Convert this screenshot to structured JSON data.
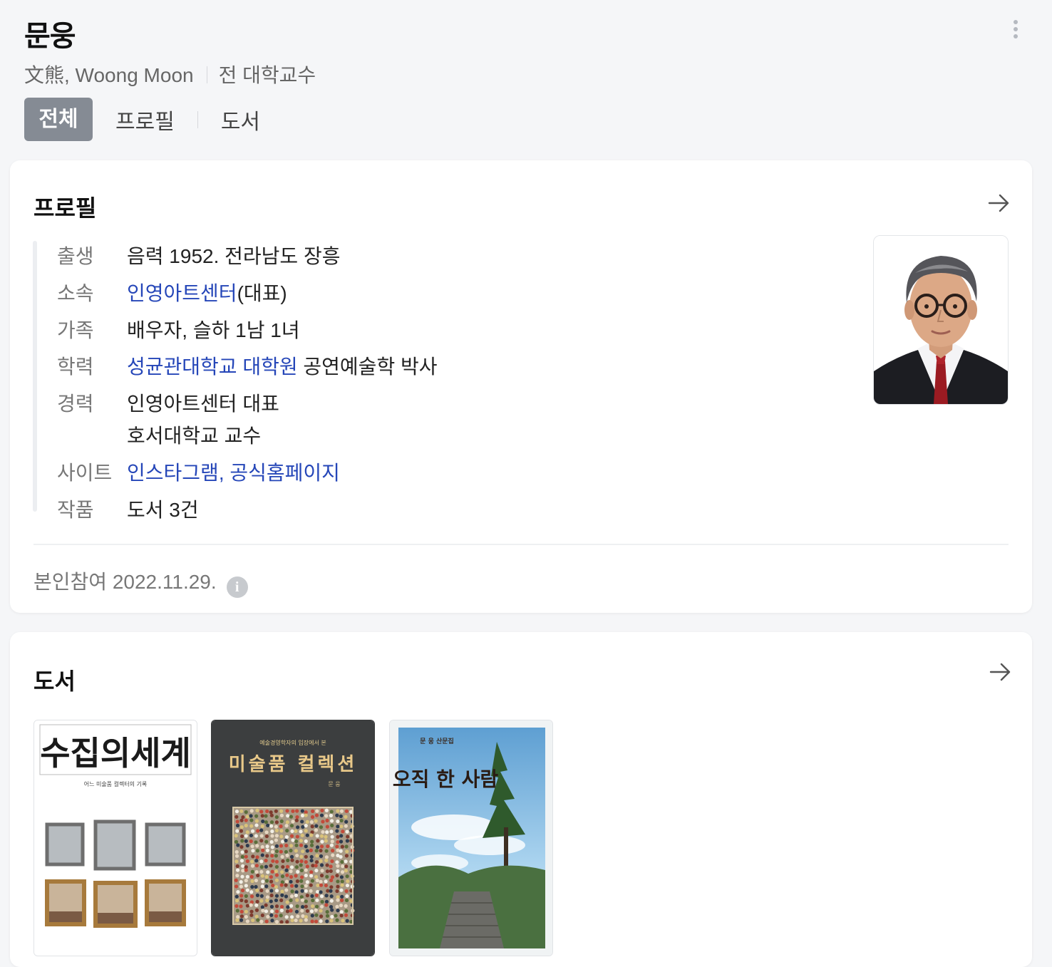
{
  "person": {
    "name": "문웅",
    "alias": "文熊, Woong Moon",
    "occupation": "전 대학교수"
  },
  "tabs": [
    {
      "label": "전체",
      "active": true
    },
    {
      "label": "프로필",
      "active": false
    },
    {
      "label": "도서",
      "active": false
    }
  ],
  "profile": {
    "title": "프로필",
    "rows": {
      "birth": {
        "label": "출생",
        "value": "음력 1952. 전라남도 장흥"
      },
      "affiliation": {
        "label": "소속",
        "link": "인영아트센터",
        "suffix": "(대표)"
      },
      "family": {
        "label": "가족",
        "value": "배우자, 슬하 1남 1녀"
      },
      "education": {
        "label": "학력",
        "link": "성균관대학교 대학원",
        "suffix": " 공연예술학 박사"
      },
      "career": {
        "label": "경력",
        "values": [
          "인영아트센터 대표",
          "호서대학교 교수"
        ]
      },
      "site": {
        "label": "사이트",
        "links": [
          "인스타그램",
          "공식홈페이지"
        ],
        "separator": ", "
      },
      "works": {
        "label": "작품",
        "link": "도서 3건"
      }
    },
    "participation": "본인참여 2022.11.29."
  },
  "books": {
    "title": "도서",
    "items": [
      {
        "title": "수집의세계",
        "subtitle": "어느 미술품 컬렉터의 기록",
        "cover_color": "#ffffff"
      },
      {
        "title": "미술품 컬렉션",
        "subtitle": "예술경영학자의 입장에서 본",
        "author": "문 웅",
        "cover_color": "#3c3e3f"
      },
      {
        "title": "오직 한 사람",
        "subtitle": "문 웅 산문집",
        "cover_color": "#8fbde0"
      }
    ]
  },
  "colors": {
    "link": "#2546b8",
    "active_tab": "#858b94",
    "background": "#f5f6f8"
  },
  "icons": [
    "more-vertical-icon",
    "arrow-right-icon",
    "info-icon"
  ]
}
